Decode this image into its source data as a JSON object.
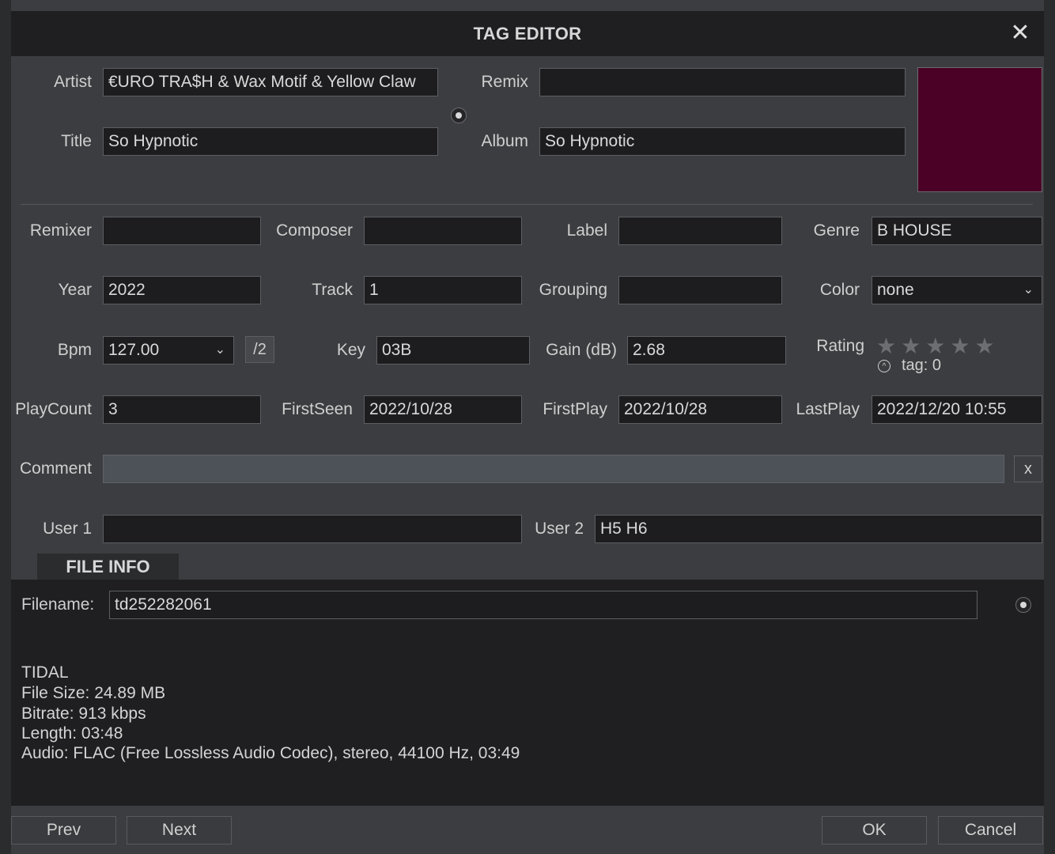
{
  "window": {
    "title": "TAG EDITOR",
    "close_icon": "close-icon"
  },
  "tags": {
    "artist": {
      "label": "Artist",
      "value": "€URO TRA$H & Wax Motif & Yellow Claw"
    },
    "title": {
      "label": "Title",
      "value": "So Hypnotic"
    },
    "remix": {
      "label": "Remix",
      "value": ""
    },
    "album": {
      "label": "Album",
      "value": "So Hypnotic"
    },
    "cover_color": "#4a0125",
    "remixer": {
      "label": "Remixer",
      "value": ""
    },
    "composer": {
      "label": "Composer",
      "value": ""
    },
    "label": {
      "label": "Label",
      "value": ""
    },
    "genre": {
      "label": "Genre",
      "value": "B HOUSE"
    },
    "year": {
      "label": "Year",
      "value": "2022"
    },
    "track": {
      "label": "Track",
      "value": "1"
    },
    "grouping": {
      "label": "Grouping",
      "value": ""
    },
    "color": {
      "label": "Color",
      "value": "none"
    },
    "bpm": {
      "label": "Bpm",
      "value": "127.00",
      "half_label": "/2"
    },
    "key": {
      "label": "Key",
      "value": "03B"
    },
    "gain": {
      "label": "Gain (dB)",
      "value": "2.68"
    },
    "rating": {
      "label": "Rating",
      "stars": 0,
      "max": 5,
      "tag_text": "tag: 0"
    },
    "playcount": {
      "label": "PlayCount",
      "value": "3"
    },
    "firstseen": {
      "label": "FirstSeen",
      "value": "2022/10/28"
    },
    "firstplay": {
      "label": "FirstPlay",
      "value": "2022/10/28"
    },
    "lastplay": {
      "label": "LastPlay",
      "value": "2022/12/20 10:55"
    },
    "comment": {
      "label": "Comment",
      "value": "",
      "clear_label": "x"
    },
    "user1": {
      "label": "User 1",
      "value": ""
    },
    "user2": {
      "label": "User 2",
      "value": "H5 H6"
    }
  },
  "file_info": {
    "tab_label": "FILE INFO",
    "filename_label": "Filename:",
    "filename": "td252282061",
    "source": "TIDAL",
    "file_size": "File Size: 24.89 MB",
    "bitrate": "Bitrate: 913 kbps",
    "length": "Length: 03:48",
    "audio": "Audio: FLAC (Free Lossless Audio Codec), stereo, 44100 Hz, 03:49"
  },
  "buttons": {
    "prev": "Prev",
    "next": "Next",
    "ok": "OK",
    "cancel": "Cancel"
  }
}
